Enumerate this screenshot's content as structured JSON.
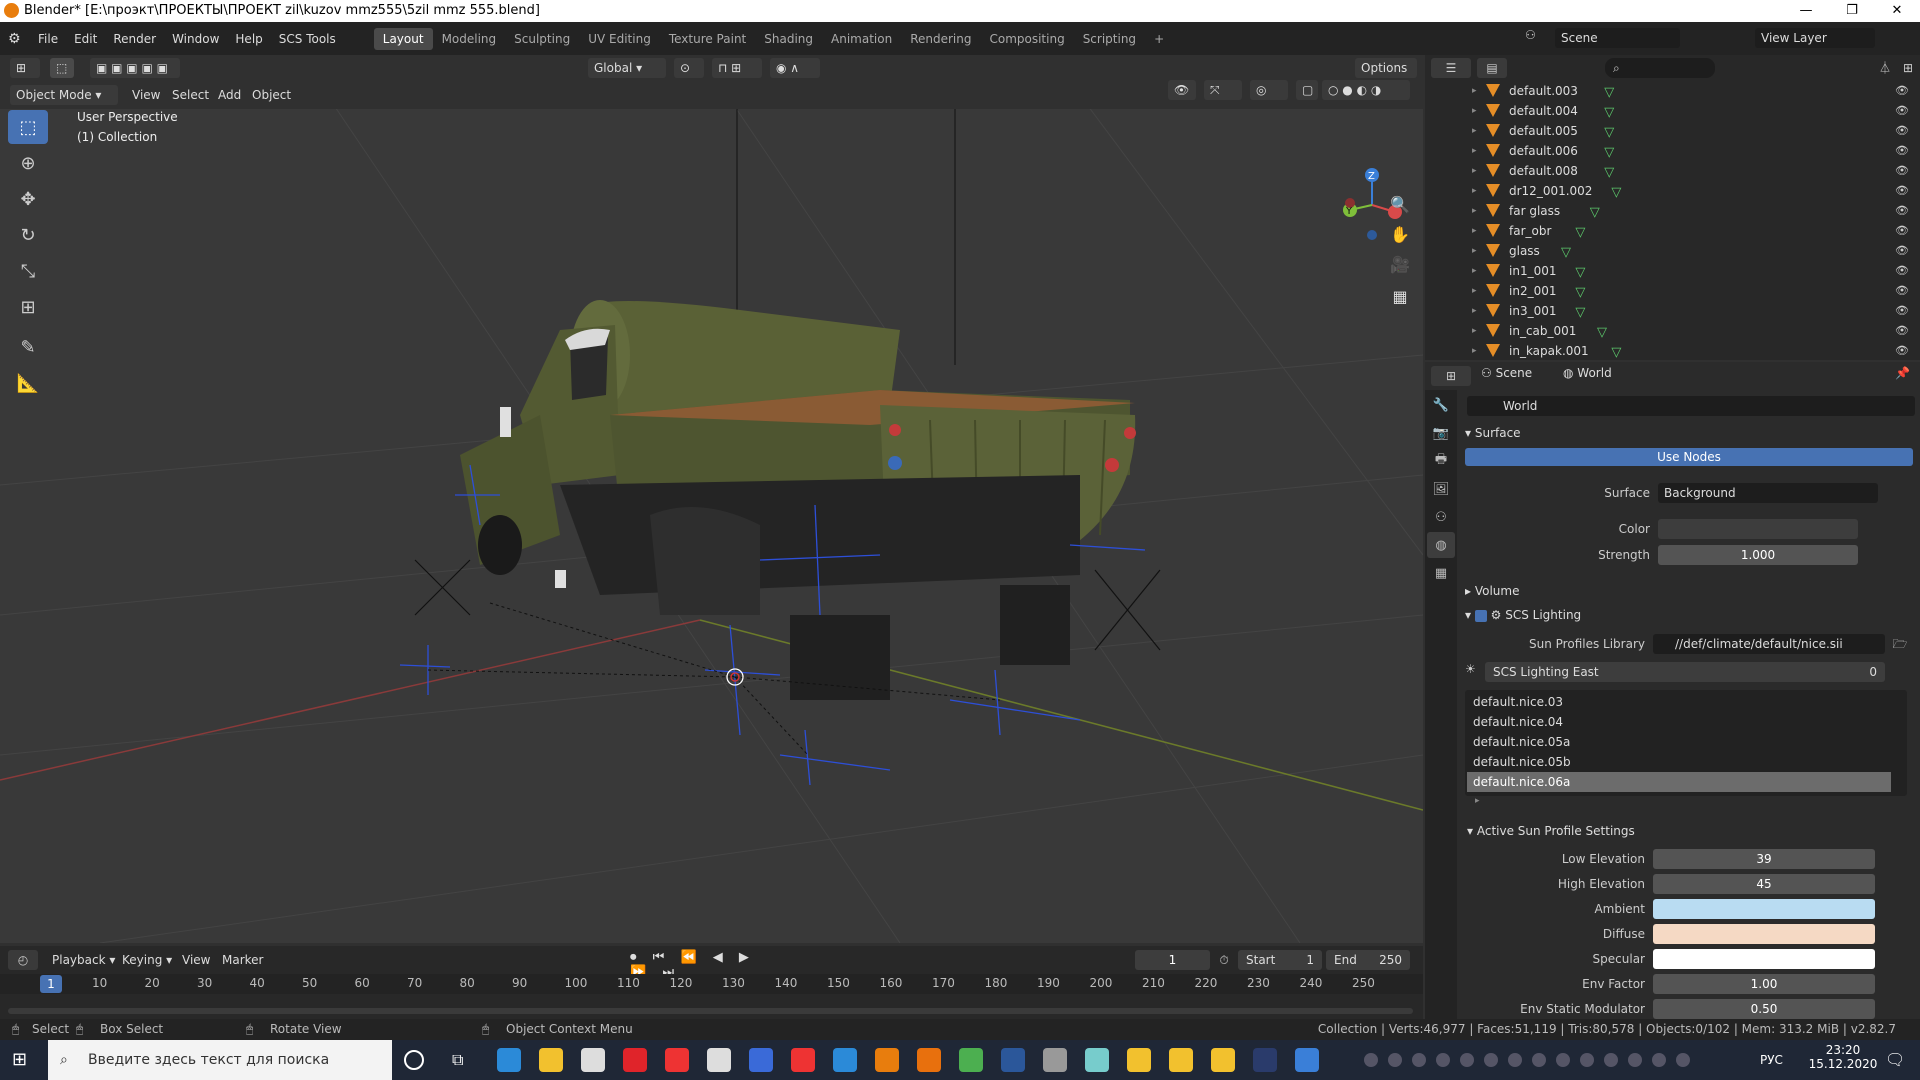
{
  "window": {
    "title": "Blender* [E:\\проэкт\\ПРОЕКТЫ\\ПРОЕКТ zil\\kuzov mmz555\\5zil mmz 555.blend]",
    "min": "—",
    "max": "❐",
    "close": "✕"
  },
  "menu": [
    "File",
    "Edit",
    "Render",
    "Window",
    "Help",
    "SCS Tools"
  ],
  "workspaces": [
    "Layout",
    "Modeling",
    "Sculpting",
    "UV Editing",
    "Texture Paint",
    "Shading",
    "Animation",
    "Rendering",
    "Compositing",
    "Scripting"
  ],
  "workspace_add": "+",
  "topright": {
    "scene": "Scene",
    "view_layer": "View Layer"
  },
  "viewport_header": {
    "mode": "Object Mode",
    "menus": [
      "View",
      "Select",
      "Add",
      "Object"
    ],
    "transform": "Global",
    "options": "Options"
  },
  "viewport": {
    "perspective": "User Perspective",
    "collection": "(1) Collection",
    "gizmo_z": "Z",
    "gizmo_y": "Y"
  },
  "outliner": {
    "items": [
      "default.003",
      "default.004",
      "default.005",
      "default.006",
      "default.008",
      "dr12_001.002",
      "far glass",
      "far_obr",
      "glass",
      "in1_001",
      "in2_001",
      "in3_001",
      "in_cab_001",
      "in_kapak.001"
    ]
  },
  "properties": {
    "breadcrumb_scene": "Scene",
    "breadcrumb_world": "World",
    "world_name": "World",
    "surface_panel": "Surface",
    "use_nodes": "Use Nodes",
    "surface_label": "Surface",
    "surface_value": "Background",
    "color_label": "Color",
    "strength_label": "Strength",
    "strength_value": "1.000",
    "volume_panel": "Volume",
    "scs_panel": "SCS Lighting",
    "sun_lib_label": "Sun Profiles Library",
    "sun_lib_value": "//def/climate/default/nice.sii",
    "lighting_east": "SCS Lighting East",
    "lighting_east_value": "0",
    "profiles": [
      "default.nice.03",
      "default.nice.04",
      "default.nice.05a",
      "default.nice.05b",
      "default.nice.06a"
    ],
    "active_panel": "Active Sun Profile Settings",
    "low_elev_label": "Low Elevation",
    "low_elev": "39",
    "high_elev_label": "High Elevation",
    "high_elev": "45",
    "ambient_label": "Ambient",
    "ambient_color": "#b9dcf2",
    "diffuse_label": "Diffuse",
    "diffuse_color": "#f5d9c4",
    "specular_label": "Specular",
    "specular_color": "#ffffff",
    "env_factor_label": "Env Factor",
    "env_factor": "1.00",
    "env_static_label": "Env Static Modulator",
    "env_static": "0.50"
  },
  "timeline": {
    "menus": [
      "Playback",
      "Keying",
      "View",
      "Marker"
    ],
    "current_frame": "1",
    "start_label": "Start",
    "start": "1",
    "end_label": "End",
    "end": "250",
    "ticks": [
      "10",
      "20",
      "30",
      "40",
      "50",
      "60",
      "70",
      "80",
      "90",
      "100",
      "110",
      "120",
      "130",
      "140",
      "150",
      "160",
      "170",
      "180",
      "190",
      "200",
      "210",
      "220",
      "230",
      "240",
      "250"
    ],
    "marker": "1"
  },
  "status": {
    "select": "Select",
    "box_select": "Box Select",
    "rotate": "Rotate View",
    "context": "Object Context Menu",
    "stats": "Collection | Verts:46,977 | Faces:51,119 | Tris:80,578 | Objects:0/102 | Mem: 313.2 MiB | v2.82.7"
  },
  "taskbar": {
    "search_placeholder": "Введите здесь текст для поиска",
    "lang": "РУС",
    "time": "23:20",
    "date": "15.12.2020"
  }
}
